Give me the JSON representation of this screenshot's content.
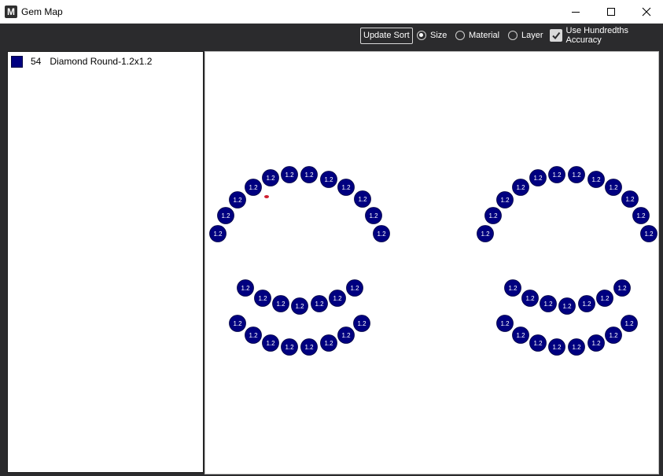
{
  "window": {
    "title": "Gem Map",
    "app_icon": "M"
  },
  "toolbar": {
    "update_label": "Update Sort",
    "sort_options": [
      {
        "label": "Size",
        "checked": true
      },
      {
        "label": "Material",
        "checked": false
      },
      {
        "label": "Layer",
        "checked": false
      }
    ],
    "accuracy_label": "Use Hundredths Accuracy",
    "accuracy_checked": true
  },
  "gem_list": [
    {
      "count": "54",
      "name": "Diamond Round-1.2x1.2",
      "color": "#000080"
    }
  ],
  "gem_map": {
    "gem_label": "1.2",
    "gem_color": "#000080",
    "gem_count": 54
  }
}
